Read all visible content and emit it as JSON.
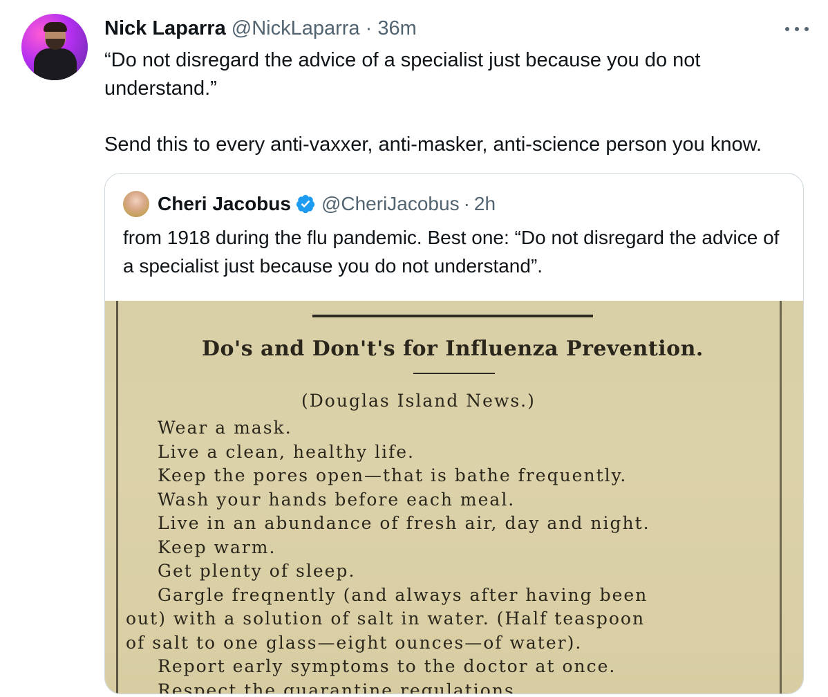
{
  "tweet": {
    "author_name": "Nick Laparra",
    "author_handle": "@NickLaparra",
    "separator": "·",
    "time": "36m",
    "text_paragraph_1": "“Do not disregard the advice of a specialist just because you do not understand.”",
    "text_paragraph_2": "Send this to every anti-vaxxer, anti-masker, anti-science person you know."
  },
  "quoted_tweet": {
    "author_name": "Cheri Jacobus",
    "author_handle": "@CheriJacobus",
    "separator": "·",
    "time": "2h",
    "text": "from 1918 during the flu pandemic.  Best one: “Do not disregard the advice of a specialist just because you do not understand”."
  },
  "clipping": {
    "headline": "Do's and Don't's for Influenza Prevention.",
    "source": "(Douglas Island News.)",
    "lines": [
      "Wear a mask.",
      "Live a clean, healthy life.",
      "Keep the pores open—that is bathe frequently.",
      "Wash your hands before each meal.",
      "Live in an abundance of fresh air, day and night.",
      "Keep warm.",
      "Get plenty of sleep.",
      "Gargle freqnently (and always after having been",
      "out) with a solution of salt in water. (Half teaspoon",
      "of salt to one glass—eight ounces—of water).",
      "Report early symptoms to the doctor at once.",
      "Respect the quarantine regulations."
    ]
  },
  "icons": {
    "more": "more-horizontal-icon",
    "verified": "verified-badge-icon"
  },
  "colors": {
    "text": "#0f1419",
    "secondary": "#536471",
    "verified": "#1d9bf0",
    "card_border": "#cfd9de",
    "newsprint": "#dcd2aa"
  }
}
